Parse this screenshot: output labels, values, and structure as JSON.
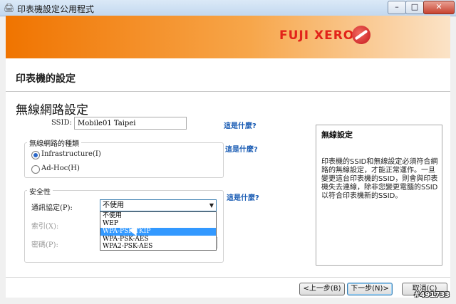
{
  "window": {
    "title": "印表機設定公用程式",
    "min_label": "–",
    "max_label": "□",
    "close_label": "✕"
  },
  "brand": {
    "logo_text": "FUJI XEROX"
  },
  "page": {
    "title": "印表機的設定",
    "section_title": "無線網路設定"
  },
  "ssid": {
    "label": "SSID:",
    "value": "Mobile01 Taipei"
  },
  "help_link": "這是什麼?",
  "network_type": {
    "title": "無線網路的種類",
    "options": [
      {
        "label": "Infrastructure(I)",
        "checked": true
      },
      {
        "label": "Ad-Hoc(H)",
        "checked": false
      }
    ]
  },
  "security": {
    "title": "安全性",
    "protocol_label": "通訊協定(P):",
    "protocol_selected": "不使用",
    "index_label": "索引(X):",
    "password_label": "密碼(P):",
    "dropdown_options": [
      "不使用",
      "WEP",
      "WPA-PSK-TKIP",
      "WPA-PSK-AES",
      "WPA2-PSK-AES"
    ],
    "highlighted_index": 2
  },
  "info": {
    "title": "無線設定",
    "text": "印表機的SSID和無線設定必須符合網路的無線設定，才能正常運作。一旦變更這台印表機的SSID，則會與印表機失去連線，除非您變更電腦的SSID以符合印表機新的SSID。"
  },
  "buttons": {
    "back": "<上一步(B)",
    "next": "下一步(N)>",
    "cancel": "取消(C)"
  },
  "watermark": "#491733",
  "colors": {
    "banner": "#f07400",
    "link": "#1a5cb4",
    "selection": "#3399ff",
    "logo": "#e2231a"
  }
}
